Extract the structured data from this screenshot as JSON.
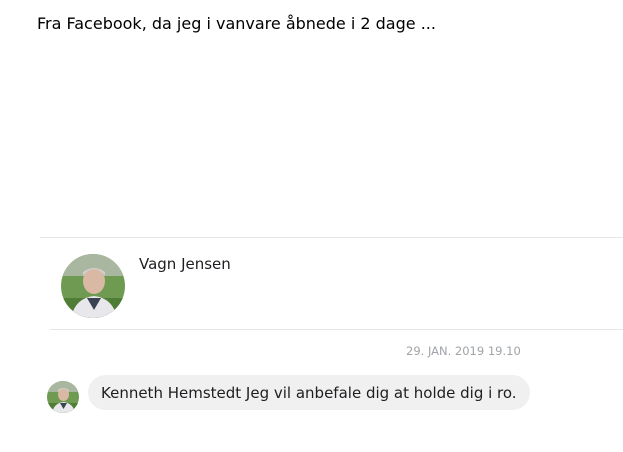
{
  "caption": "Fra Facebook, da jeg i vanvare åbnede i 2 dage ...",
  "conversation": {
    "contact_name": "Vagn Jensen",
    "timestamp": "29. JAN. 2019 19.10",
    "message": "Kenneth Hemstedt Jeg vil anbefale dig at holde dig i ro."
  },
  "colors": {
    "bubble_background": "#f1f0f0",
    "timestamp_text": "#a0a4a8",
    "divider": "#e6e6e6"
  },
  "icons": {
    "contact_avatar": "user-photo-avatar",
    "sender_avatar": "user-photo-avatar"
  }
}
